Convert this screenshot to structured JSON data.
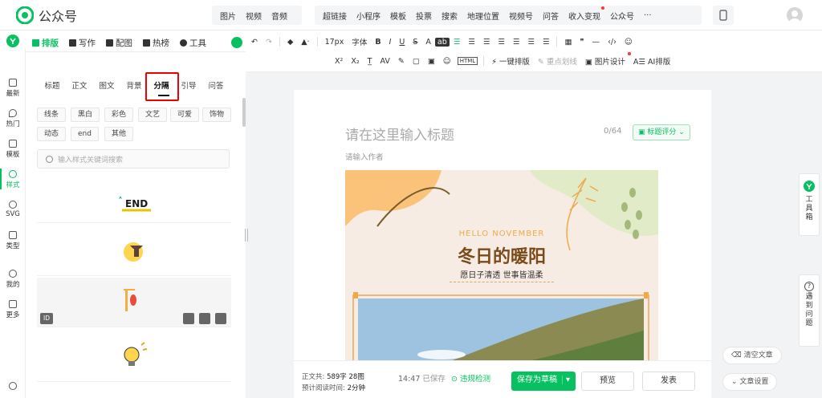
{
  "header": {
    "app_title": "公众号",
    "menu_group1": [
      "图片",
      "视频",
      "音频"
    ],
    "menu_group2": [
      "超链接",
      "小程序",
      "模板",
      "投票",
      "搜索",
      "地理位置",
      "视频号",
      "问答",
      "收入变现",
      "公众号",
      "···"
    ]
  },
  "leftnav": {
    "items": [
      {
        "label": "最新",
        "icon": "video-icon"
      },
      {
        "label": "热门",
        "icon": "flame-icon"
      },
      {
        "label": "模板",
        "icon": "template-icon"
      },
      {
        "label": "样式",
        "icon": "style-icon",
        "active": true
      },
      {
        "label": "SVG",
        "icon": "svg-icon"
      },
      {
        "label": "类型",
        "icon": "type-icon"
      },
      {
        "label": "我的",
        "icon": "user-icon"
      },
      {
        "label": "更多",
        "icon": "grid-icon"
      }
    ]
  },
  "panel": {
    "tabs": [
      "排版",
      "写作",
      "配图",
      "热榜",
      "工具"
    ],
    "subtabs": [
      "标题",
      "正文",
      "图文",
      "背景",
      "分隔",
      "引导",
      "问答"
    ],
    "tags": [
      "线条",
      "黑白",
      "彩色",
      "文艺",
      "可爱",
      "饰物",
      "动态",
      "end",
      "其他"
    ],
    "search_placeholder": "输入样式关键词搜索",
    "card1_text": "END",
    "id_label": "ID"
  },
  "toolbar": {
    "row1": [
      "↶",
      "↷",
      "17px",
      "字体",
      "B",
      "I",
      "U",
      "S",
      "A",
      "ab"
    ],
    "row2": [
      "X²",
      "X₂",
      "AV",
      "HTML",
      "一键排版",
      "重点划线",
      "图片设计",
      "AI排版"
    ]
  },
  "editor": {
    "title_placeholder": "请在这里输入标题",
    "title_count": "0/64",
    "score_label": "标题评分",
    "author_placeholder": "请输入作者",
    "article": {
      "subtitle": "HELLO NOVEMBER",
      "heading": "冬日的暖阳",
      "tagline": "愿日子清透 世事皆温柔"
    }
  },
  "footer": {
    "wordcount_label": "正文共:",
    "wordcount_value": "589字 28图",
    "readtime_label": "预计阅读时间:",
    "readtime_value": "2分钟",
    "saved_time": "14:47",
    "saved_label": "已保存",
    "check_label": "违规检测",
    "save_draft": "保存为草稿",
    "preview": "预览",
    "publish": "发表"
  },
  "right": {
    "toolbox": "工具箱",
    "problem": "遇到问题",
    "clear": "清空文章",
    "settings": "文章设置"
  },
  "colors": {
    "accent": "#07c160"
  }
}
